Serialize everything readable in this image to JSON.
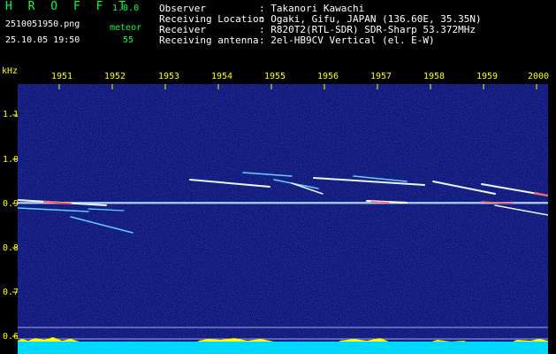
{
  "header": {
    "app_name": "H R O F F T",
    "version": "1.0.0",
    "file_name": "2510051950.png",
    "timestamp": "25.10.05 19:50",
    "mode_label": "meteor",
    "meteor_count": "55"
  },
  "info": {
    "rows": [
      {
        "label": "Observer",
        "value": ": Takanori Kawachi"
      },
      {
        "label": "Receiving Location",
        "value": ": Ogaki, Gifu, JAPAN (136.60E, 35.35N)"
      },
      {
        "label": "Receiver",
        "value": ": R820T2(RTL-SDR) SDR-Sharp 53.372MHz"
      },
      {
        "label": "Receiving antenna",
        "value": ": 2el-HB9CV Vertical (el. E-W)"
      }
    ]
  },
  "axes": {
    "y_unit": "kHz",
    "y_ticks": [
      "1.1",
      "1.0",
      "0.9",
      "0.8",
      "0.7",
      "0.6"
    ],
    "x_ticks": [
      "1951",
      "1952",
      "1953",
      "1954",
      "1955",
      "1956",
      "1957",
      "1958",
      "1959",
      "2000"
    ]
  },
  "colors": {
    "background": "#000000",
    "plot_background": "#0a0f6e",
    "header_green": "#00ff44",
    "header_white": "#ffffff",
    "axis_yellow": "#ffff00",
    "trace_white": "#e8f4ff",
    "trace_cyan": "#66ccff",
    "footer_cyan": "#00d8ff",
    "footer_yellow": "#ffff00"
  }
}
